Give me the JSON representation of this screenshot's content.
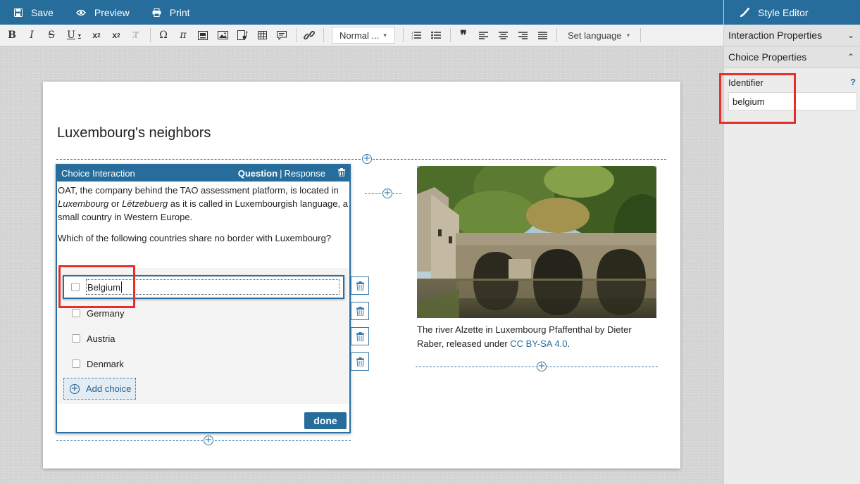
{
  "topbar": {
    "save_label": "Save",
    "preview_label": "Preview",
    "print_label": "Print",
    "background_color": "#266d9c"
  },
  "toolbar": {
    "format_select": "Normal ...",
    "set_language": "Set language",
    "buttons": [
      "bold-icon",
      "italic-icon",
      "strikethrough-icon",
      "underline-icon",
      "subscript-icon",
      "superscript-icon",
      "remove-format-icon",
      "special-character-icon",
      "pi-math-icon",
      "media-icon",
      "image-icon",
      "audio-icon",
      "table-icon",
      "comment-icon",
      "link-icon",
      "numbered-list-icon",
      "bulleted-list-icon",
      "blockquote-icon",
      "align-left-icon",
      "align-center-icon",
      "align-right-icon",
      "justify-icon"
    ]
  },
  "sidebar": {
    "style_editor_label": "Style Editor",
    "interaction_properties_label": "Interaction Properties",
    "choice_properties_label": "Choice Properties",
    "identifier_label": "Identifier",
    "help_label": "?",
    "identifier_value": "belgium"
  },
  "item": {
    "title": "Luxembourg's neighbors",
    "interaction": {
      "type_label": "Choice Interaction",
      "question_tab": "Question",
      "tab_separator": "|",
      "response_tab": "Response",
      "prompt_p1_a": "OAT, the company behind the TAO assessment platform, is located in ",
      "prompt_p1_lux": "Luxembourg",
      "prompt_p1_or": " or ",
      "prompt_p1_letz": "Lëtzebuerg",
      "prompt_p1_b": " as it is called in Luxembourgish language, a small country in Western Europe.",
      "prompt_p2": "Which of the following countries share no border with Luxembourg?",
      "choices": [
        "Belgium",
        "Germany",
        "Austria",
        "Denmark"
      ],
      "add_choice_label": "Add choice",
      "done_label": "done"
    },
    "caption_text": "The river Alzette in Luxembourg Pfaffenthal by Dieter Raber, released under ",
    "license_link": "CC BY-SA 4.0",
    "caption_end": "."
  },
  "colors": {
    "accent": "#266d9c",
    "highlight": "#e5302a"
  }
}
